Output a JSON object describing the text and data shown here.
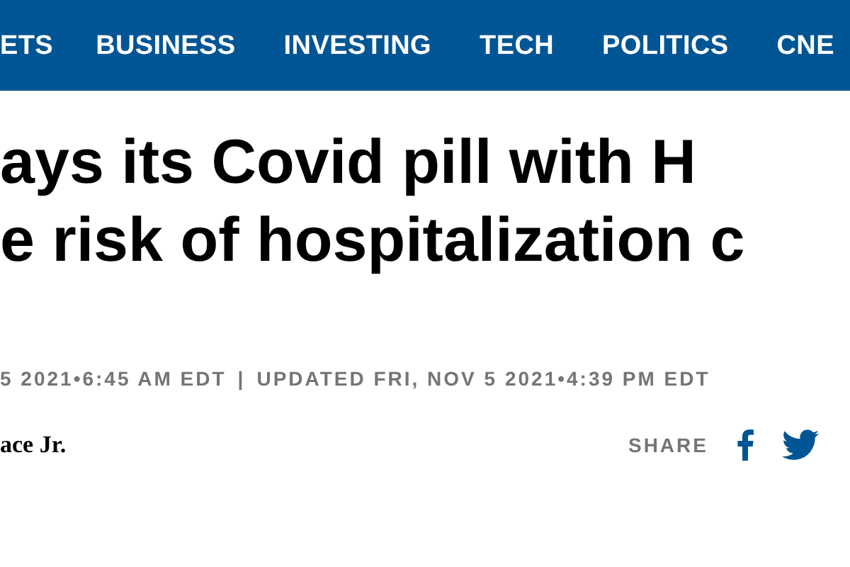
{
  "nav": {
    "items": [
      "ETS",
      "BUSINESS",
      "INVESTING",
      "TECH",
      "POLITICS",
      "CNE"
    ]
  },
  "headline": {
    "lines": [
      "ays its Covid pill with H",
      "e risk of hospitalization c"
    ]
  },
  "timestamp": {
    "published": "5 2021•6:45 AM EDT",
    "separator": "|",
    "updated": "UPDATED FRI, NOV 5 2021•4:39 PM EDT"
  },
  "byline": "ace Jr.",
  "share": {
    "label": "SHARE"
  }
}
